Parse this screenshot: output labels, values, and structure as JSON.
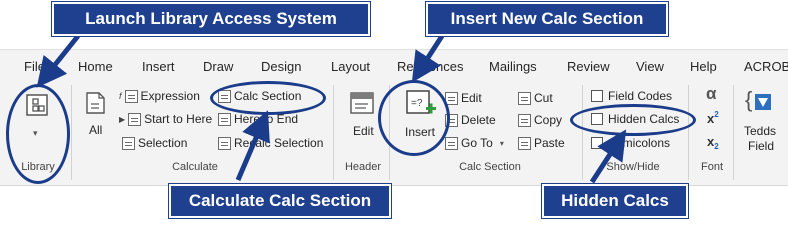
{
  "callouts": {
    "launch": "Launch Library Access System",
    "insert_new": "Insert New Calc Section",
    "calculate": "Calculate Calc Section",
    "hidden": "Hidden Calcs"
  },
  "tabs": [
    "File",
    "Home",
    "Insert",
    "Draw",
    "Design",
    "Layout",
    "References",
    "Mailings",
    "Review",
    "View",
    "Help",
    "ACROBA"
  ],
  "library": {
    "group_label": "Library",
    "dropdown_glyph": "▾"
  },
  "calculate": {
    "all_label": "All",
    "expression_label": "Expression",
    "start_to_here_label": "Start to Here",
    "selection_label": "Selection",
    "calc_section_label": "Calc Section",
    "here_to_end_label": "Here to End",
    "recalc_selection_label": "Recalc Selection",
    "group_label": "Calculate"
  },
  "header": {
    "edit_label": "Edit",
    "group_label": "Header"
  },
  "calc_section": {
    "insert_label": "Insert",
    "edit_label": "Edit",
    "delete_label": "Delete",
    "goto_label": "Go To",
    "cut_label": "Cut",
    "copy_label": "Copy",
    "paste_label": "Paste",
    "group_label": "Calc Section"
  },
  "show_hide": {
    "field_codes_label": "Field Codes",
    "hidden_calcs_label": "Hidden Calcs",
    "semicolons_label": "Semicolons",
    "group_label": "Show/Hide"
  },
  "font": {
    "alpha_glyph": "α",
    "x_label": "x",
    "sup_label": "2",
    "sub_label": "2",
    "group_label": "Font"
  },
  "tedds": {
    "line1": "Tedds",
    "line2": "Field"
  },
  "colors": {
    "callout_bg": "#1f3f8f",
    "ring": "#1b3c8a",
    "ribbon_bg": "#f3f3f3",
    "insert_plus": "#2e9e3a"
  }
}
